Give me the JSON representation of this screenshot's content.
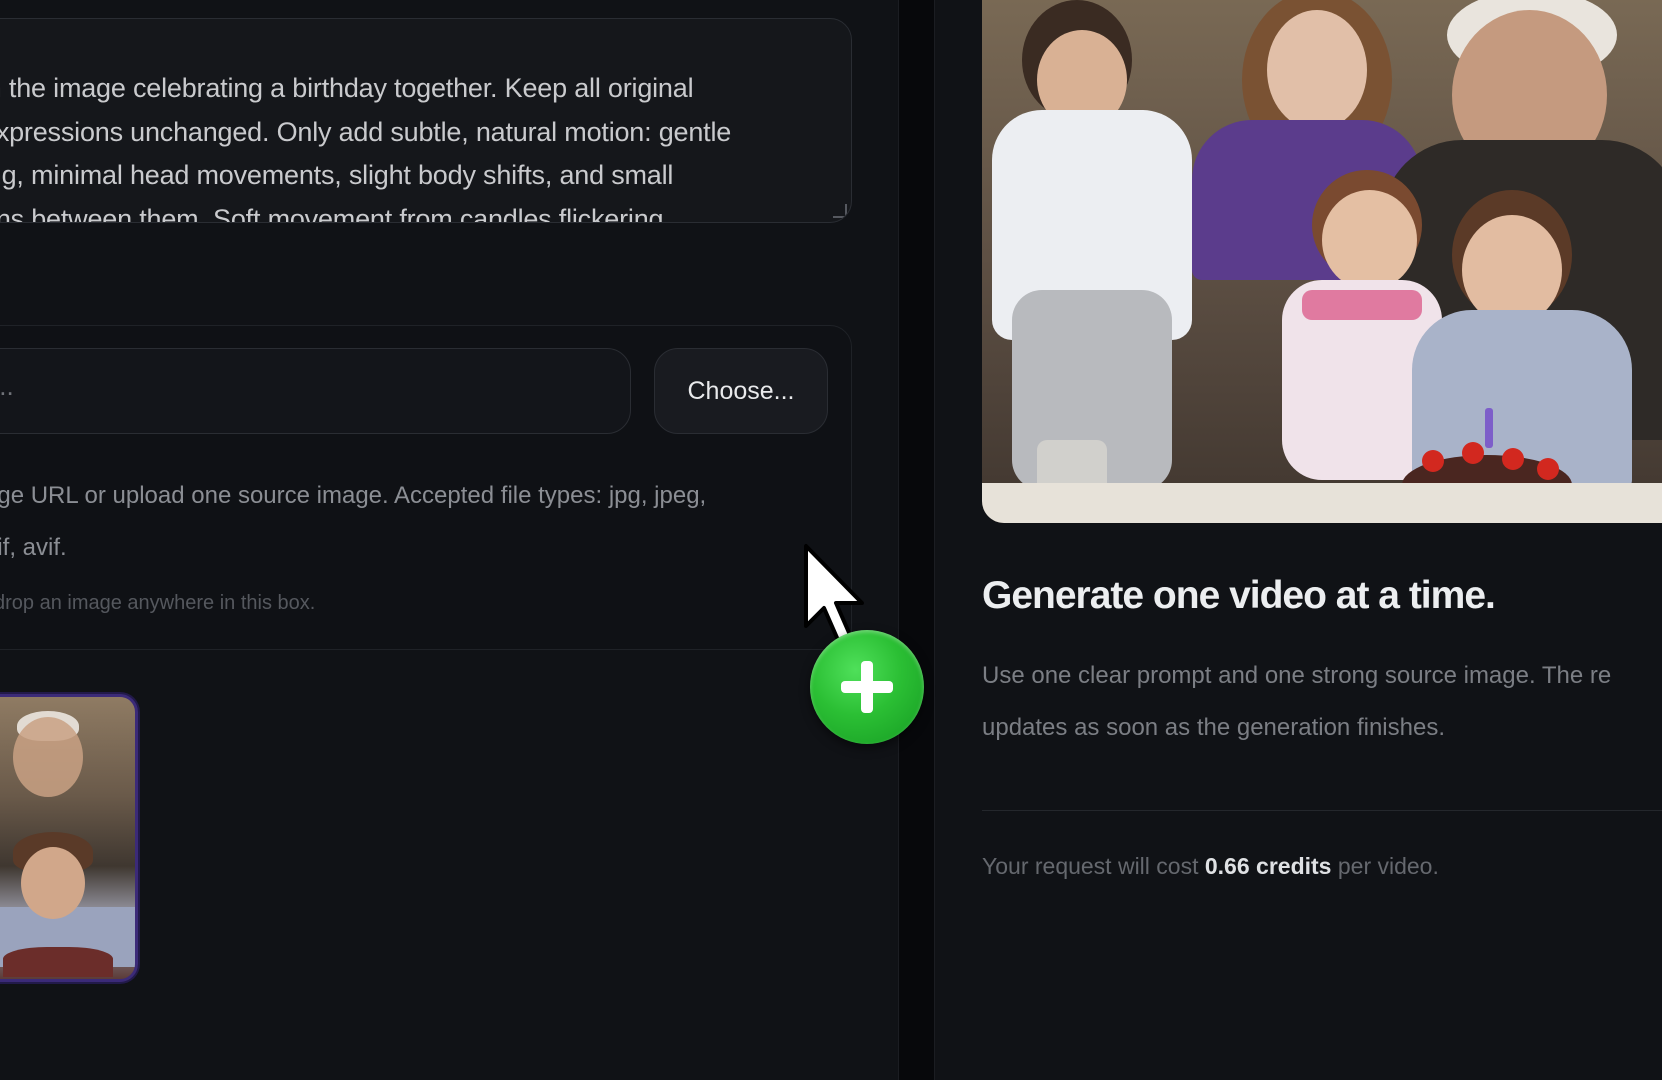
{
  "prompt": {
    "lines": [
      "in the image celebrating a birthday together. Keep all original",
      "expressions unchanged. Only add subtle, natural motion: gentle",
      "ing, minimal head movements, slight body shifts, and small",
      "ons between them. Soft movement from candles flickering"
    ]
  },
  "source": {
    "url_placeholder": "...",
    "choose_label": "Choose...",
    "help_lines": [
      "age URL or upload one source image. Accepted file types: jpg, jpeg,",
      "gif, avif."
    ],
    "drop_hint": "drop an image anywhere in this box."
  },
  "right": {
    "title": "Generate one video at a time.",
    "desc_lines": [
      "Use one clear prompt and one strong source image. The re",
      "updates as soon as the generation finishes."
    ],
    "cost_prefix": "Your request will cost ",
    "cost_value": "0.66 credits",
    "cost_suffix": " per video."
  },
  "colors": {
    "add_badge": "#2bbf34",
    "thumb_border": "#3b2a78",
    "background": "#101216"
  },
  "icons": {
    "cursor": "arrow-cursor-icon",
    "add": "plus-icon"
  }
}
